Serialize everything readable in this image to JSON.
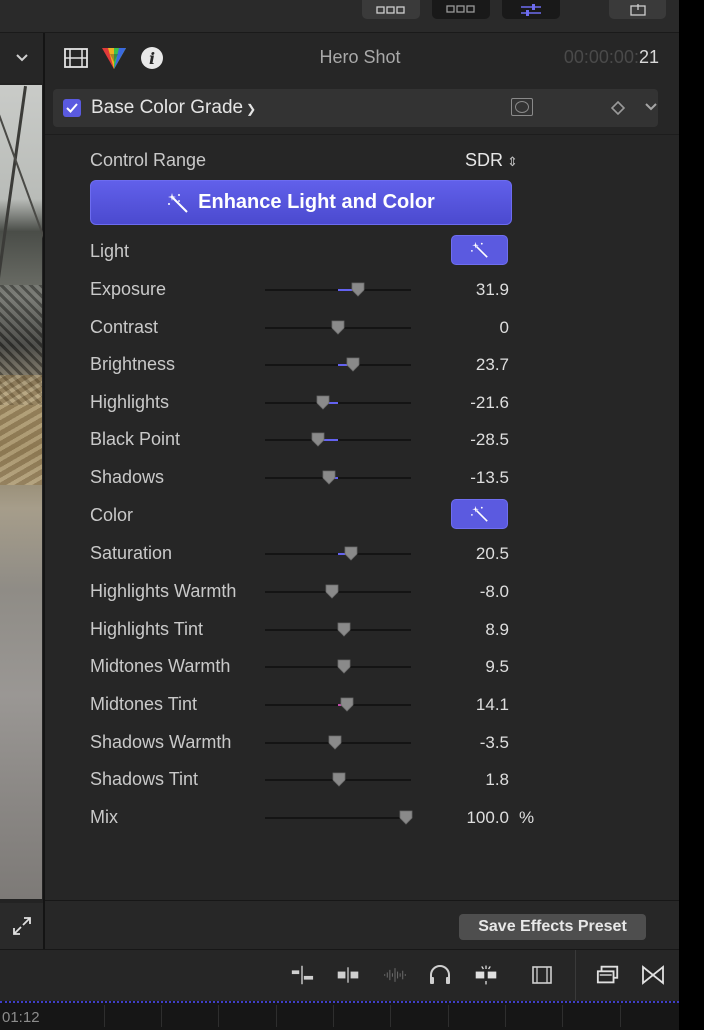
{
  "inspector": {
    "clip_title": "Hero Shot",
    "timecode_dim": "00:00:00:",
    "timecode_frames": "21",
    "effect_name": "Base Color Grade",
    "effect_enabled": true
  },
  "control_range": {
    "label": "Control Range",
    "value": "SDR"
  },
  "enhance_button": {
    "label": "Enhance Light and Color"
  },
  "sections": {
    "light": "Light",
    "color": "Color"
  },
  "params": [
    {
      "label": "Exposure",
      "value": "31.9",
      "pos": 0.64,
      "fill_from": 0.5,
      "fill_color": "#6362f0"
    },
    {
      "label": "Contrast",
      "value": "0",
      "pos": 0.5,
      "fill_from": 0.5,
      "fill_color": "#6362f0"
    },
    {
      "label": "Brightness",
      "value": "23.7",
      "pos": 0.6,
      "fill_from": 0.5,
      "fill_color": "#6362f0"
    },
    {
      "label": "Highlights",
      "value": "-21.6",
      "pos": 0.4,
      "fill_from": 0.5,
      "fill_color": "#6362f0"
    },
    {
      "label": "Black Point",
      "value": "-28.5",
      "pos": 0.36,
      "fill_from": 0.5,
      "fill_color": "#6362f0"
    },
    {
      "label": "Shadows",
      "value": "-13.5",
      "pos": 0.44,
      "fill_from": 0.5,
      "fill_color": "#6362f0"
    },
    {
      "label": "Saturation",
      "value": "20.5",
      "pos": 0.59,
      "fill_from": 0.5,
      "fill_color": "#6362f0"
    },
    {
      "label": "Highlights Warmth",
      "value": "-8.0",
      "pos": 0.46,
      "fill_from": 0.46,
      "fill_color": "#6362f0"
    },
    {
      "label": "Highlights Tint",
      "value": "8.9",
      "pos": 0.54,
      "fill_from": 0.54,
      "fill_color": "#6362f0"
    },
    {
      "label": "Midtones Warmth",
      "value": "9.5",
      "pos": 0.54,
      "fill_from": 0.54,
      "fill_color": "#6362f0"
    },
    {
      "label": "Midtones Tint",
      "value": "14.1",
      "pos": 0.56,
      "fill_from": 0.5,
      "fill_color": "#c04aa8"
    },
    {
      "label": "Shadows Warmth",
      "value": "-3.5",
      "pos": 0.48,
      "fill_from": 0.48,
      "fill_color": "#6362f0"
    },
    {
      "label": "Shadows Tint",
      "value": "1.8",
      "pos": 0.51,
      "fill_from": 0.51,
      "fill_color": "#6362f0"
    },
    {
      "label": "Mix",
      "value": "100.0",
      "unit": "%",
      "pos": 0.965,
      "fill_from": 0.965,
      "fill_color": "#6362f0"
    }
  ],
  "footer": {
    "save_preset": "Save Effects Preset"
  },
  "timeline": {
    "timecode": "01:12"
  },
  "colors": {
    "accent": "#5b5ae0",
    "panel": "#262626"
  }
}
